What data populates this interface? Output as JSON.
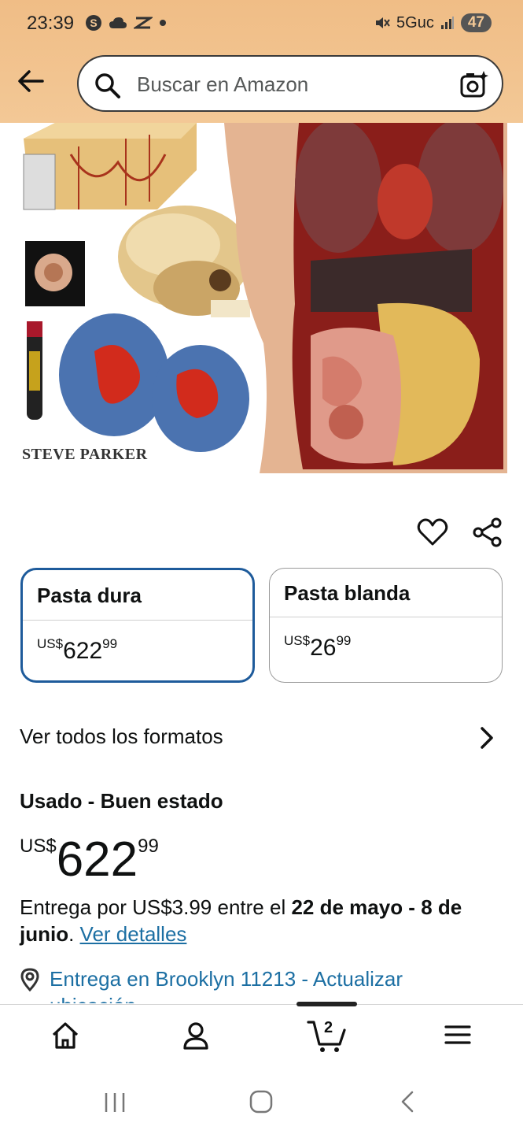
{
  "status_bar": {
    "time": "23:39",
    "network": "5Guc",
    "battery": "47",
    "icons": [
      "s-icon",
      "cloud-icon",
      "sync-icon",
      "dot-icon",
      "mute-icon",
      "signal-icon"
    ]
  },
  "search": {
    "placeholder": "Buscar en Amazon"
  },
  "product": {
    "image_author_text": "STEVE PARKER"
  },
  "formats": [
    {
      "label": "Pasta dura",
      "currency": "US$",
      "whole": "622",
      "fraction": "99",
      "selected": true
    },
    {
      "label": "Pasta blanda",
      "currency": "US$",
      "whole": "26",
      "fraction": "99",
      "selected": false
    }
  ],
  "all_formats_label": "Ver todos los formatos",
  "offer": {
    "condition": "Usado - Buen estado",
    "currency": "US$",
    "whole": "622",
    "fraction": "99"
  },
  "delivery": {
    "prefix": "Entrega por US$3.99 entre el ",
    "dates": "22 de mayo - 8 de junio",
    "suffix": ". ",
    "details_link": "Ver detalles"
  },
  "location": {
    "text_line1": "Entrega en Brooklyn 11213 - Actualizar",
    "text_line2": "ubicación"
  },
  "bottom_nav": {
    "cart_count": "2",
    "items": [
      "home-icon",
      "account-icon",
      "cart-icon",
      "menu-icon"
    ]
  },
  "colors": {
    "header_bg": "#f0bd86",
    "selected_border": "#1e5b9b",
    "link": "#1c6fa3"
  }
}
